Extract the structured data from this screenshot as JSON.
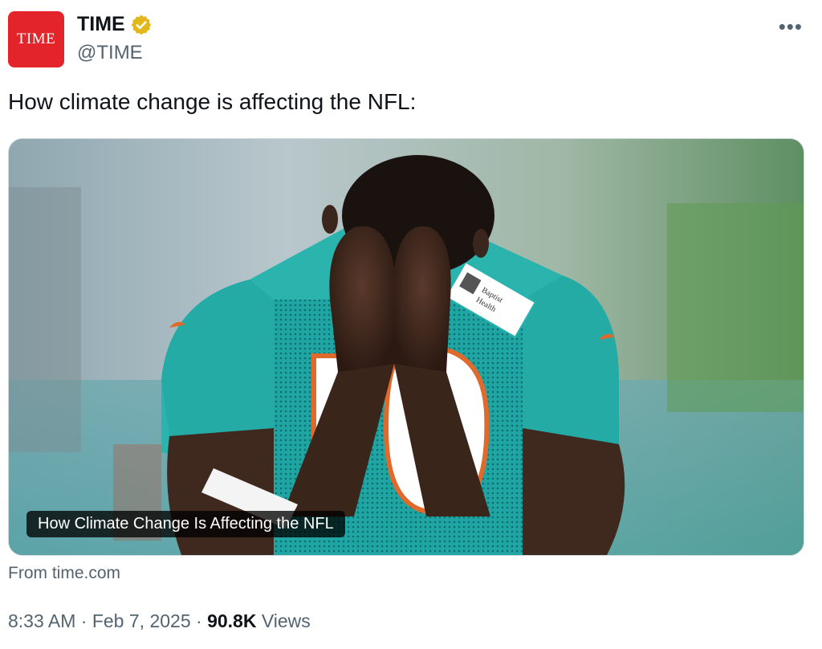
{
  "author": {
    "avatar_text": "TIME",
    "display_name": "TIME",
    "handle": "@TIME",
    "verified_icon": "gold-verified-badge-icon",
    "brand_color": "#e3242b"
  },
  "more_icon": "more-options-icon",
  "tweet": {
    "text": "How climate change is affecting the NFL:"
  },
  "card": {
    "caption": "How Climate Change Is Affecting the NFL",
    "jersey_number": "10",
    "patch_text": [
      "Baptist",
      "Health"
    ],
    "source": "From time.com"
  },
  "meta": {
    "time": "8:33 AM",
    "separator": "·",
    "date": "Feb 7, 2025",
    "views_count": "90.8K",
    "views_label": "Views"
  }
}
